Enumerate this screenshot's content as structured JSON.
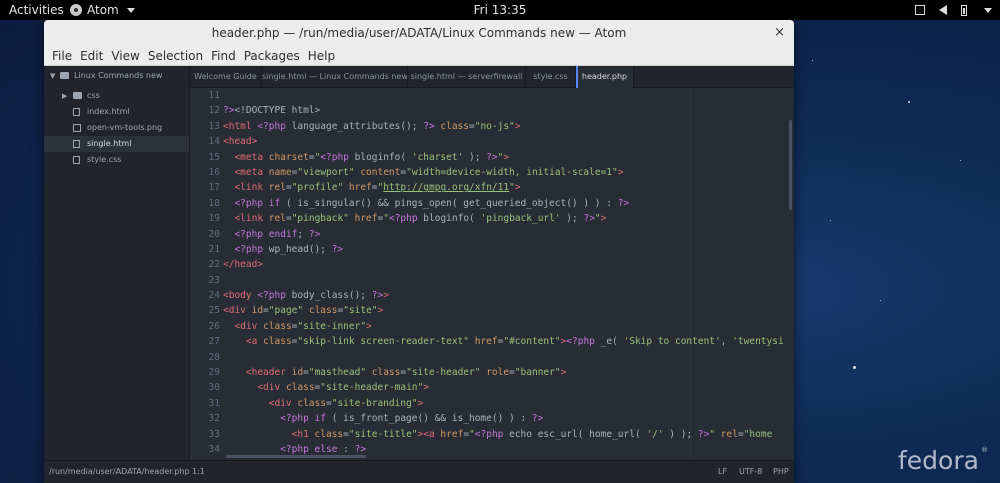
{
  "topbar": {
    "activities": "Activities",
    "app_name": "Atom",
    "clock": "Fri 13:35"
  },
  "window": {
    "title": "header.php — /run/media/user/ADATA/Linux Commands new — Atom",
    "close": "×"
  },
  "menu": [
    "File",
    "Edit",
    "View",
    "Selection",
    "Find",
    "Packages",
    "Help"
  ],
  "tree": {
    "root": "Linux Commands new",
    "items": [
      {
        "label": "css",
        "type": "folder"
      },
      {
        "label": "index.html",
        "type": "file"
      },
      {
        "label": "open-vm-tools.png",
        "type": "image"
      },
      {
        "label": "single.html",
        "type": "file",
        "selected": true
      },
      {
        "label": "style.css",
        "type": "file"
      }
    ]
  },
  "tabs": [
    {
      "label": "Welcome Guide"
    },
    {
      "label": "single.html — Linux Commands new"
    },
    {
      "label": "single.html — serverfirewall"
    },
    {
      "label": "style.css"
    },
    {
      "label": "header.php",
      "active": true
    }
  ],
  "editor": {
    "line_numbers": [
      "11",
      "12",
      "13",
      "14",
      "15",
      "16",
      "17",
      "18",
      "19",
      "20",
      "21",
      "22",
      "23",
      "24",
      "25",
      "26",
      "27",
      "28",
      "29",
      "30",
      "31",
      "32",
      "33",
      "34"
    ],
    "lines": [
      [],
      [
        [
          "k",
          "?>"
        ],
        [
          "",
          "<!DOCTYPE html>"
        ]
      ],
      [
        [
          "t",
          "<html"
        ],
        [
          "",
          ""
        ],
        [
          "k",
          " <?php"
        ],
        [
          "",
          " language_attributes(); "
        ],
        [
          "k",
          "?>"
        ],
        [
          "a",
          " class"
        ],
        [
          "",
          "="
        ],
        [
          "s",
          "\"no-js\""
        ],
        [
          "t",
          ">"
        ]
      ],
      [
        [
          "t",
          "<head>"
        ]
      ],
      [
        [
          "",
          "  "
        ],
        [
          "t",
          "<meta"
        ],
        [
          "a",
          " charset"
        ],
        [
          "",
          "="
        ],
        [
          "s",
          "\""
        ],
        [
          "k",
          "<?php"
        ],
        [
          "",
          " bloginfo( "
        ],
        [
          "s",
          "'charset'"
        ],
        [
          "",
          " ); "
        ],
        [
          "k",
          "?>"
        ],
        [
          "s",
          "\""
        ],
        [
          "t",
          ">"
        ]
      ],
      [
        [
          "",
          "  "
        ],
        [
          "t",
          "<meta"
        ],
        [
          "a",
          " name"
        ],
        [
          "",
          "="
        ],
        [
          "s",
          "\"viewport\""
        ],
        [
          "a",
          " content"
        ],
        [
          "",
          "="
        ],
        [
          "s",
          "\"width=device-width, initial-scale=1\""
        ],
        [
          "t",
          ">"
        ]
      ],
      [
        [
          "",
          "  "
        ],
        [
          "t",
          "<link"
        ],
        [
          "a",
          " rel"
        ],
        [
          "",
          "="
        ],
        [
          "s",
          "\"profile\""
        ],
        [
          "a",
          " href"
        ],
        [
          "",
          "="
        ],
        [
          "s",
          "\""
        ],
        [
          "u",
          "http://gmpg.org/xfn/11"
        ],
        [
          "s",
          "\""
        ],
        [
          "t",
          ">"
        ]
      ],
      [
        [
          "",
          "  "
        ],
        [
          "k",
          "<?php"
        ],
        [
          "k",
          " if"
        ],
        [
          "",
          " ( is_singular() && pings_open( get_queried_object() ) ) : "
        ],
        [
          "k",
          "?>"
        ]
      ],
      [
        [
          "",
          "  "
        ],
        [
          "t",
          "<link"
        ],
        [
          "a",
          " rel"
        ],
        [
          "",
          "="
        ],
        [
          "s",
          "\"pingback\""
        ],
        [
          "a",
          " href"
        ],
        [
          "",
          "="
        ],
        [
          "s",
          "\""
        ],
        [
          "k",
          "<?php"
        ],
        [
          "",
          " bloginfo( "
        ],
        [
          "s",
          "'pingback_url'"
        ],
        [
          "",
          " ); "
        ],
        [
          "k",
          "?>"
        ],
        [
          "s",
          "\""
        ],
        [
          "t",
          ">"
        ]
      ],
      [
        [
          "",
          "  "
        ],
        [
          "k",
          "<?php"
        ],
        [
          "k",
          " endif"
        ],
        [
          "",
          "; "
        ],
        [
          "k",
          "?>"
        ]
      ],
      [
        [
          "",
          "  "
        ],
        [
          "k",
          "<?php"
        ],
        [
          "",
          " wp_head(); "
        ],
        [
          "k",
          "?>"
        ]
      ],
      [
        [
          "t",
          "</head>"
        ]
      ],
      [],
      [
        [
          "t",
          "<body"
        ],
        [
          "k",
          " <?php"
        ],
        [
          "",
          " body_class(); "
        ],
        [
          "k",
          "?>"
        ],
        [
          "t",
          ">"
        ]
      ],
      [
        [
          "t",
          "<div"
        ],
        [
          "a",
          " id"
        ],
        [
          "",
          "="
        ],
        [
          "s",
          "\"page\""
        ],
        [
          "a",
          " class"
        ],
        [
          "",
          "="
        ],
        [
          "s",
          "\"site\""
        ],
        [
          "t",
          ">"
        ]
      ],
      [
        [
          "",
          "  "
        ],
        [
          "t",
          "<div"
        ],
        [
          "a",
          " class"
        ],
        [
          "",
          "="
        ],
        [
          "s",
          "\"site-inner\""
        ],
        [
          "t",
          ">"
        ]
      ],
      [
        [
          "",
          "    "
        ],
        [
          "t",
          "<a"
        ],
        [
          "a",
          " class"
        ],
        [
          "",
          "="
        ],
        [
          "s",
          "\"skip-link screen-reader-text\""
        ],
        [
          "a",
          " href"
        ],
        [
          "",
          "="
        ],
        [
          "s",
          "\"#content\""
        ],
        [
          "t",
          ">"
        ],
        [
          "k",
          "<?php"
        ],
        [
          "",
          " _e( "
        ],
        [
          "s",
          "'Skip to content'"
        ],
        [
          "",
          ", "
        ],
        [
          "s",
          "'twentysi"
        ]
      ],
      [],
      [
        [
          "",
          "    "
        ],
        [
          "t",
          "<header"
        ],
        [
          "a",
          " id"
        ],
        [
          "",
          "="
        ],
        [
          "s",
          "\"masthead\""
        ],
        [
          "a",
          " class"
        ],
        [
          "",
          "="
        ],
        [
          "s",
          "\"site-header\""
        ],
        [
          "a",
          " role"
        ],
        [
          "",
          "="
        ],
        [
          "s",
          "\"banner\""
        ],
        [
          "t",
          ">"
        ]
      ],
      [
        [
          "",
          "      "
        ],
        [
          "t",
          "<div"
        ],
        [
          "a",
          " class"
        ],
        [
          "",
          "="
        ],
        [
          "s",
          "\"site-header-main\""
        ],
        [
          "t",
          ">"
        ]
      ],
      [
        [
          "",
          "        "
        ],
        [
          "t",
          "<div"
        ],
        [
          "a",
          " class"
        ],
        [
          "",
          "="
        ],
        [
          "s",
          "\"site-branding\""
        ],
        [
          "t",
          ">"
        ]
      ],
      [
        [
          "",
          "          "
        ],
        [
          "k",
          "<?php"
        ],
        [
          "k",
          " if"
        ],
        [
          "",
          " ( is_front_page() && is_home() ) : "
        ],
        [
          "k",
          "?>"
        ]
      ],
      [
        [
          "",
          "            "
        ],
        [
          "t",
          "<h1"
        ],
        [
          "a",
          " class"
        ],
        [
          "",
          "="
        ],
        [
          "s",
          "\"site-title\""
        ],
        [
          "t",
          ">"
        ],
        [
          "t",
          "<a"
        ],
        [
          "a",
          " href"
        ],
        [
          "",
          "="
        ],
        [
          "s",
          "\""
        ],
        [
          "k",
          "<?php"
        ],
        [
          "",
          " echo esc_url( home_url( "
        ],
        [
          "s",
          "'/'"
        ],
        [
          "",
          " ) ); "
        ],
        [
          "k",
          "?>"
        ],
        [
          "s",
          "\""
        ],
        [
          "a",
          " rel"
        ],
        [
          "",
          "="
        ],
        [
          "s",
          "\"home"
        ]
      ],
      [
        [
          "",
          "          "
        ],
        [
          "k",
          "<?php"
        ],
        [
          "k",
          " else"
        ],
        [
          "",
          " : "
        ],
        [
          "k",
          "?>"
        ]
      ]
    ]
  },
  "status": {
    "path": "/run/media/user/ADATA/header.php",
    "cursor": "1:1",
    "line_ending": "LF",
    "encoding": "UTF-8",
    "grammar": "PHP"
  },
  "branding": {
    "logo_text": "fedora",
    "logo_mark": "®"
  },
  "colors": {
    "editor_bg": "#282c34",
    "panel_bg": "#21252b",
    "tag": "#e06c75",
    "attribute": "#d19a66",
    "string": "#98c379",
    "keyword": "#c678dd"
  }
}
